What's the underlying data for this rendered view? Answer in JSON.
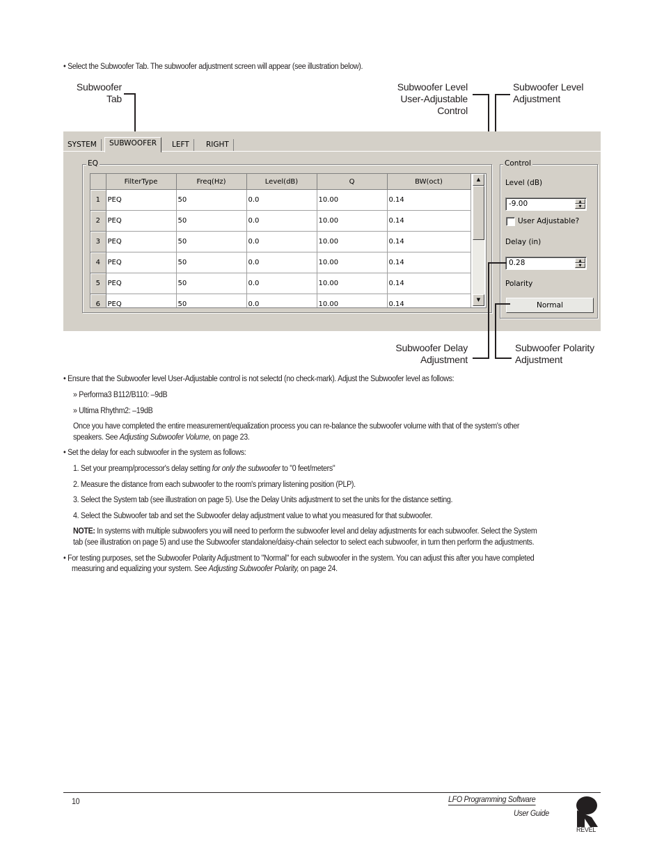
{
  "intro_bullet": "• Select the Subwoofer Tab. The subwoofer adjustment screen will appear (see illustration below).",
  "callouts": {
    "subwoofer_tab": [
      "Subwoofer",
      "Tab"
    ],
    "level_user_adjustable": [
      "Subwoofer Level",
      "User-Adjustable",
      "Control"
    ],
    "level_adjustment": [
      "Subwoofer Level",
      "Adjustment"
    ],
    "delay_adjustment": [
      "Subwoofer Delay",
      "Adjustment"
    ],
    "polarity_adjustment": [
      "Subwoofer Polarity",
      "Adjustment"
    ]
  },
  "ui": {
    "tabs": [
      {
        "label": "SYSTEM",
        "active": false
      },
      {
        "label": "SUBWOOFER",
        "active": true
      },
      {
        "label": "LEFT",
        "active": false
      },
      {
        "label": "RIGHT",
        "active": false
      }
    ],
    "eq_group_label": "EQ",
    "columns": [
      "FilterType",
      "Freq(Hz)",
      "Level(dB)",
      "Q",
      "BW(oct)"
    ],
    "rows": [
      {
        "num": "1",
        "filter": "PEQ",
        "freq": "50",
        "level": "0.0",
        "q": "10.00",
        "bw": "0.14"
      },
      {
        "num": "2",
        "filter": "PEQ",
        "freq": "50",
        "level": "0.0",
        "q": "10.00",
        "bw": "0.14"
      },
      {
        "num": "3",
        "filter": "PEQ",
        "freq": "50",
        "level": "0.0",
        "q": "10.00",
        "bw": "0.14"
      },
      {
        "num": "4",
        "filter": "PEQ",
        "freq": "50",
        "level": "0.0",
        "q": "10.00",
        "bw": "0.14"
      },
      {
        "num": "5",
        "filter": "PEQ",
        "freq": "50",
        "level": "0.0",
        "q": "10.00",
        "bw": "0.14"
      },
      {
        "num": "6",
        "filter": "PEQ",
        "freq": "50",
        "level": "0.0",
        "q": "10.00",
        "bw": "0.14"
      }
    ],
    "control": {
      "group_label": "Control",
      "level_label": "Level (dB)",
      "level_value": "-9.00",
      "user_adjustable_label": "User Adjustable?",
      "user_adjustable_checked": false,
      "delay_label": "Delay (in)",
      "delay_value": "0.28",
      "polarity_label": "Polarity",
      "polarity_value": "Normal"
    }
  },
  "body": {
    "bullet2": "•  Ensure that the Subwoofer level User-Adjustable control is not selectd (no check-mark). Adjust the Subwoofer level as follows:",
    "sub1": "» Performa3 B112/B110: –9dB",
    "sub2": "» Ultima Rhythm2: –19dB",
    "para1_line1": "Once you have completed the entire measurement/equalization process you can re-balance the subwoofer volume with that of the system's other",
    "para1_line2_a": "speakers. See ",
    "para1_line2_ref": "Adjusting Subwoofer Volume,",
    "para1_line2_b": " on page 23.",
    "bullet3": "•  Set the delay for each subwoofer in the system as follows:",
    "step1_a": "1. Set your preamp/processor's delay setting ",
    "step1_em": "for only the subwoofer",
    "step1_b": " to \"0 feet/meters\"",
    "step2": "2. Measure the distance from each subwoofer to the room's primary listening position (PLP).",
    "step3": "3. Select the System tab (see illustration on page 5). Use the Delay Units adjustment to set the units for the distance setting.",
    "step4": "4. Select the Subwoofer tab and  set the Subwoofer delay adjustment value to what you measured for that subwoofer.",
    "note_label": "NOTE:",
    "note_line1": " In systems with multiple subwoofers you will need to perform the subwoofer level and delay adjustments for each subwoofer. Select the System",
    "note_line2": "tab (see illustration on page 5) and use the Subwoofer standalone/daisy-chain selector to select each subwoofer, in turn then perform the adjustments.",
    "bullet4_line1": "• For testing purposes, set the Subwoofer Polarity Adjustment to \"Normal\" for each subwoofer in the system. You can adjust this after you have completed",
    "bullet4_line2_a": "measuring and equalizing your system. See ",
    "bullet4_line2_ref": "Adjusting Subwoofer Polarity,",
    "bullet4_line2_b": " on page 24."
  },
  "footer": {
    "page_number": "10",
    "title": "LFO Programming Software",
    "subtitle": "User Guide",
    "logo_text": "REVEL"
  }
}
